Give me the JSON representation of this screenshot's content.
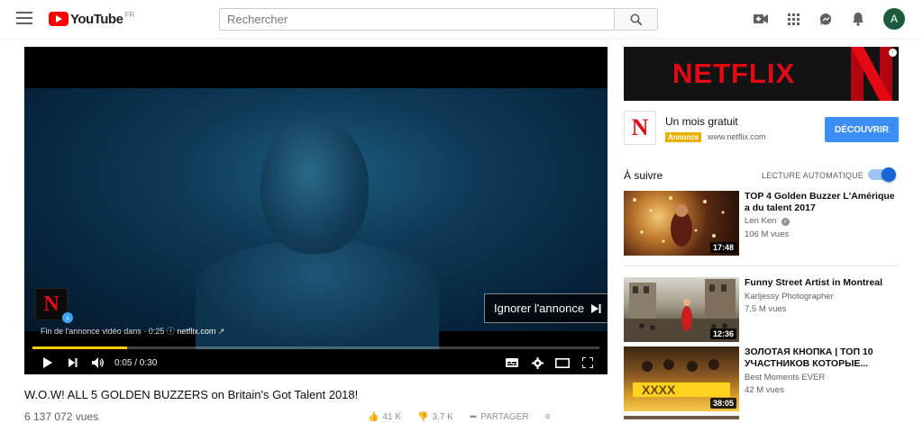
{
  "masthead": {
    "logo_text": "YouTube",
    "region": "FR",
    "search_placeholder": "Rechercher",
    "avatar_letter": "A",
    "icons": [
      "menu-icon",
      "search-icon",
      "upload-video-icon",
      "apps-grid-icon",
      "messages-icon",
      "notifications-bell-icon"
    ]
  },
  "player": {
    "ad_caption_prefix": "Fin de l'annonce vidéo dans",
    "ad_countdown": "· 0:25",
    "ad_domain": "netflix.com",
    "skip_label": "Ignorer l'annonce",
    "time": "0:05 / 0:30",
    "progress_fraction": 0.1667,
    "ad_logo_letter": "N"
  },
  "video": {
    "title": "W.O.W! ALL 5 GOLDEN BUZZERS on Britain's Got Talent 2018!",
    "views": "6 137 072 vues",
    "likes": "41 K",
    "dislikes": "3,7 K",
    "share": "PARTAGER"
  },
  "ad_sidebar": {
    "banner_word": "NETFLIX",
    "promo_title": "Un mois gratuit",
    "promo_badge": "Annonce",
    "promo_url": "www.netflix.com",
    "cta": "DÉCOUVRIR",
    "logo_letter": "N"
  },
  "up_next": {
    "label": "À suivre",
    "autoplay_label": "LECTURE AUTOMATIQUE",
    "autoplay_on": true,
    "items": [
      {
        "title": "TOP 4 Golden Buzzer L'Amérique a du talent 2017",
        "channel": "Len Ken",
        "verified": true,
        "views": "106 M vues",
        "duration": "17:48"
      },
      {
        "title": "Funny Street Artist in Montreal",
        "channel": "Karljessy Photographer",
        "verified": false,
        "views": "7,5 M vues",
        "duration": "12:36"
      },
      {
        "title": "ЗОЛОТАЯ КНОПКА | ТОП 10 УЧАСТНИКОВ КОТОРЫЕ...",
        "channel": "Best Moments EVER",
        "verified": false,
        "views": "42 M vues",
        "duration": "38:05"
      }
    ]
  },
  "colors": {
    "youtube_red": "#ff0000",
    "netflix_red": "#e50914",
    "ad_progress": "#ffcc00",
    "cta_blue": "#3a8ef6",
    "badge_yellow": "#e8b100",
    "avatar_green": "#1e5a3c"
  }
}
